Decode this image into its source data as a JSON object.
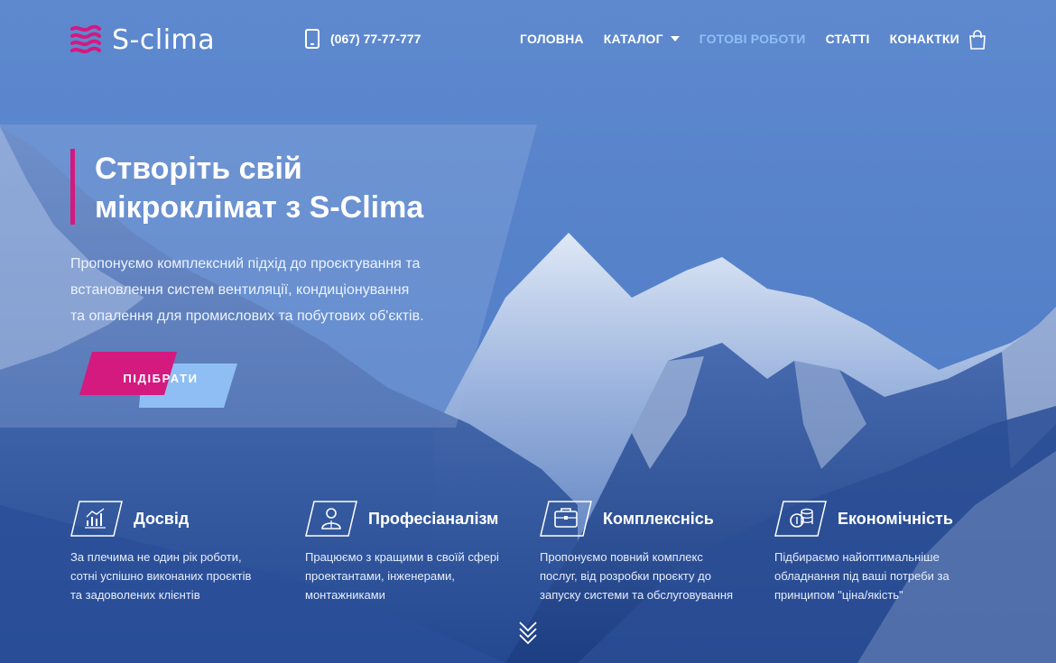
{
  "header": {
    "logo_text": "S-clima",
    "phone": "(067) 77-77-777",
    "nav": [
      {
        "label": "ГОЛОВНА",
        "active": false
      },
      {
        "label": "КАТАЛОГ",
        "active": false,
        "has_dropdown": true
      },
      {
        "label": "ГОТОВІ РОБОТИ",
        "active": true
      },
      {
        "label": "СТАТТІ",
        "active": false
      },
      {
        "label": "КОНАКТКИ",
        "active": false
      }
    ],
    "cart_icon": "shopping-bag-icon"
  },
  "hero": {
    "title_line1": "Створіть свій",
    "title_line2": "мікроклімат з S-Clima",
    "description_line1": "Пропонуємо комплексний підхід до проєктування та",
    "description_line2": "встановлення систем вентиляції, кондиціонування",
    "description_line3": "та опалення для промислових та побутових об'єктів.",
    "cta_label": "ПІДІБРАТИ"
  },
  "features": [
    {
      "icon": "chart-icon",
      "title": "Досвід",
      "lines": [
        "За плечима не один рік роботи,",
        "сотні успішно виконаних проєктів",
        "та задоволених клієнтів"
      ]
    },
    {
      "icon": "person-icon",
      "title": "Професіаналізм",
      "lines": [
        "Працюємо з кращими в своїй сфері",
        "проектантами, інженерами,",
        "монтажниками"
      ]
    },
    {
      "icon": "briefcase-icon",
      "title": "Комплекснісь",
      "lines": [
        "Пропонуємо повний комплекс",
        "послуг, від розробки проєкту до",
        "запуску системи та обслуговування"
      ]
    },
    {
      "icon": "coins-icon",
      "title": "Економічність",
      "lines": [
        "Підбираємо найоптимальніше",
        "обладнання під ваші потреби за",
        "принципом \"ціна/якість\""
      ]
    }
  ],
  "colors": {
    "accent_magenta": "#d4197f",
    "accent_light_blue": "#8fbef5",
    "background_blue": "#4c78c2"
  }
}
